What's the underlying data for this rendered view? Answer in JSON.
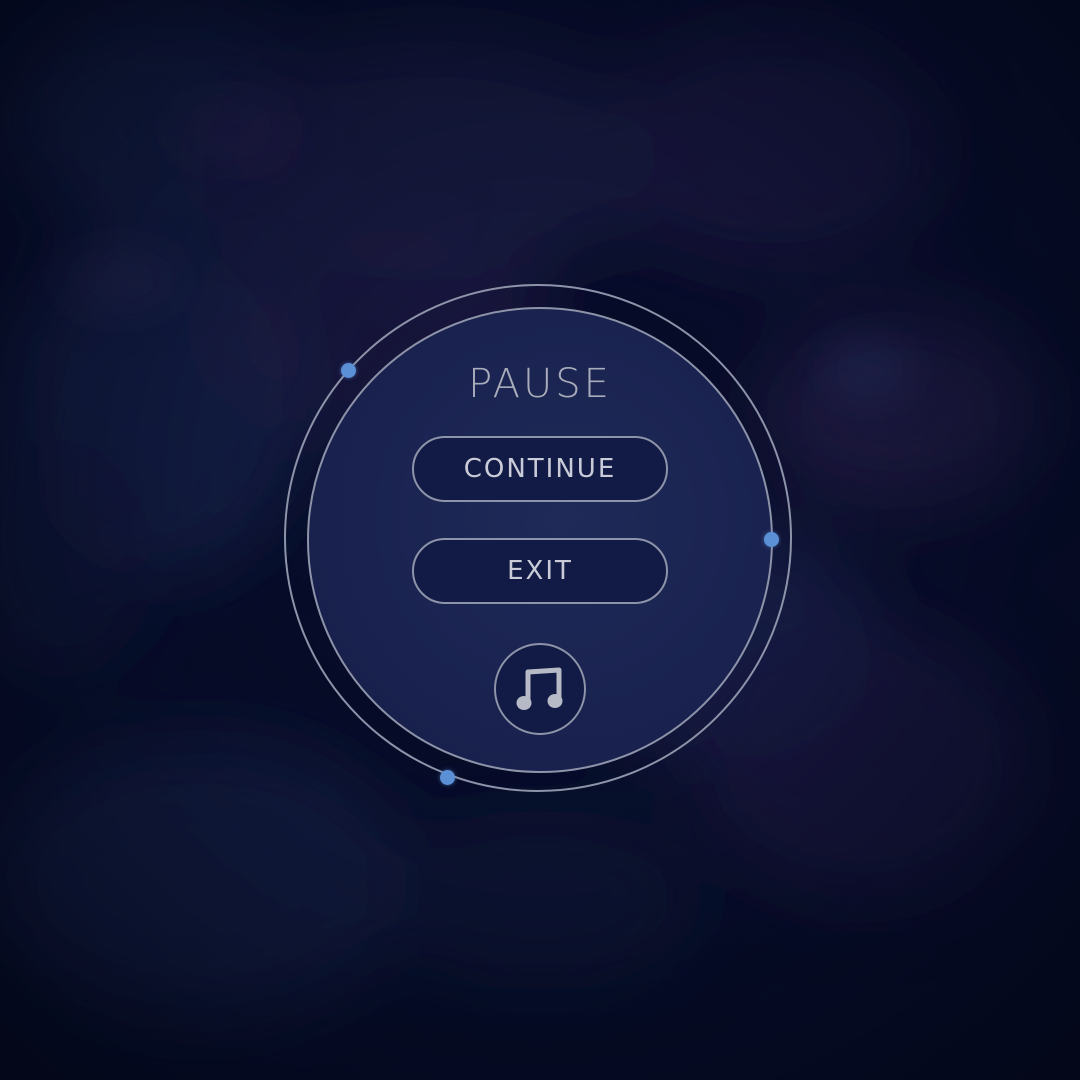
{
  "pause_menu": {
    "title": "PAUSE",
    "buttons": {
      "continue_label": "CONTINUE",
      "exit_label": "EXIT"
    },
    "music_toggle_icon": "music-note-icon"
  },
  "colors": {
    "background": "#050a22",
    "panel": "#1a2350",
    "button_fill": "#121b45",
    "outline": "#8d93a8",
    "text": "#c9ccd8",
    "accent_dot": "#5b8fd6"
  }
}
